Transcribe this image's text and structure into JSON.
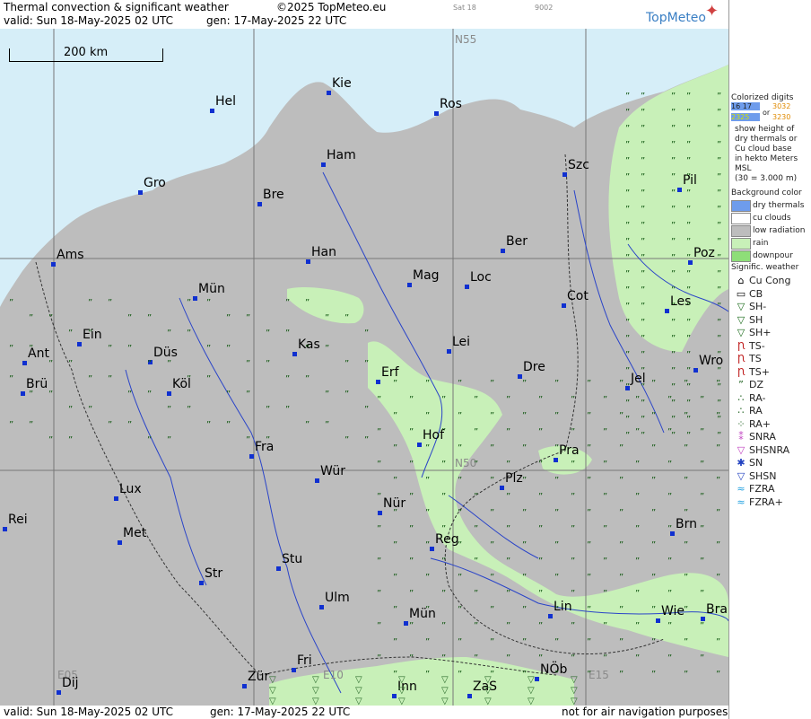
{
  "header": {
    "title": "Thermal convection & significant weather",
    "copyright": "©2025 TopMeteo.eu",
    "sat_label": "Sat 18",
    "code": "9002",
    "valid": "valid:  Sun  18-May-2025  02 UTC",
    "generated": "gen: 17-May-2025 22 UTC",
    "logo": "TopMeteo"
  },
  "footer": {
    "valid": "valid:  Sun  18-May-2025  02 UTC",
    "generated": "gen: 17-May-2025 22 UTC",
    "disclaimer": "not for air navigation purposes"
  },
  "map": {
    "scale_label": "200 km",
    "grid_labels": {
      "n55": "N55",
      "n50": "N50",
      "e05": "E05",
      "e10": "E10",
      "e15": "E15"
    },
    "cities": [
      {
        "name": "Hel"
      },
      {
        "name": "Kie"
      },
      {
        "name": "Ros"
      },
      {
        "name": "Ham"
      },
      {
        "name": "Szc"
      },
      {
        "name": "Gro"
      },
      {
        "name": "Bre"
      },
      {
        "name": "Pil"
      },
      {
        "name": "Ber"
      },
      {
        "name": "Ams"
      },
      {
        "name": "Han"
      },
      {
        "name": "Poz"
      },
      {
        "name": "Mag"
      },
      {
        "name": "Loc"
      },
      {
        "name": "Mün"
      },
      {
        "name": "Cot"
      },
      {
        "name": "Les"
      },
      {
        "name": "Ein"
      },
      {
        "name": "Kas"
      },
      {
        "name": "Lei"
      },
      {
        "name": "Ant"
      },
      {
        "name": "Düs"
      },
      {
        "name": "Wro"
      },
      {
        "name": "Dre"
      },
      {
        "name": "Erf"
      },
      {
        "name": "Brü"
      },
      {
        "name": "Köl"
      },
      {
        "name": "Jel"
      },
      {
        "name": "Hof"
      },
      {
        "name": "Fra"
      },
      {
        "name": "Pra"
      },
      {
        "name": "Wür"
      },
      {
        "name": "Plz"
      },
      {
        "name": "Lux"
      },
      {
        "name": "Nür"
      },
      {
        "name": "Rei"
      },
      {
        "name": "Brn"
      },
      {
        "name": "Met"
      },
      {
        "name": "Reg"
      },
      {
        "name": "Stu"
      },
      {
        "name": "Str"
      },
      {
        "name": "Lin"
      },
      {
        "name": "Ulm"
      },
      {
        "name": "Wie"
      },
      {
        "name": "Bra"
      },
      {
        "name": "Mün"
      },
      {
        "name": "Fri"
      },
      {
        "name": "Zür"
      },
      {
        "name": "NÖb"
      },
      {
        "name": "Dij"
      },
      {
        "name": "Inn"
      },
      {
        "name": "ZaS"
      }
    ]
  },
  "legend": {
    "digits_title": "Colorized digits",
    "digits_example_a": "16 17",
    "digits_or": "or",
    "digits_example_b1": "3032",
    "digits_example_a2": "2325",
    "digits_example_b2": "3230",
    "digits_desc": [
      "show height of",
      "dry thermals or",
      "Cu cloud base",
      "in hekto Meters",
      "MSL",
      "(30 = 3.000 m)"
    ],
    "bg_title": "Background color",
    "bg_items": [
      {
        "label": "dry thermals",
        "color": "#6e9cec"
      },
      {
        "label": "cu clouds",
        "color": "#ffffff"
      },
      {
        "label": "low radiation",
        "color": "#bdbdbd"
      },
      {
        "label": "rain",
        "color": "#c8f0b8"
      },
      {
        "label": "downpour",
        "color": "#8ede78"
      }
    ],
    "sig_title": "Signific. weather",
    "sig_items": [
      {
        "label": "Cu Cong",
        "icon": "cu-cong"
      },
      {
        "label": "CB",
        "icon": "cb"
      },
      {
        "label": "SH-",
        "icon": "shower-light"
      },
      {
        "label": "SH",
        "icon": "shower"
      },
      {
        "label": "SH+",
        "icon": "shower-heavy"
      },
      {
        "label": "TS-",
        "icon": "thunderstorm-light"
      },
      {
        "label": "TS",
        "icon": "thunderstorm"
      },
      {
        "label": "TS+",
        "icon": "thunderstorm-heavy"
      },
      {
        "label": "DZ",
        "icon": "drizzle"
      },
      {
        "label": "RA-",
        "icon": "rain-light"
      },
      {
        "label": "RA",
        "icon": "rain"
      },
      {
        "label": "RA+",
        "icon": "rain-heavy"
      },
      {
        "label": "SNRA",
        "icon": "snow-rain"
      },
      {
        "label": "SHSNRA",
        "icon": "snow-rain-shower"
      },
      {
        "label": "SN",
        "icon": "snow"
      },
      {
        "label": "SHSN",
        "icon": "snow-shower"
      },
      {
        "label": "FZRA",
        "icon": "freezing-rain"
      },
      {
        "label": "FZRA+",
        "icon": "freezing-rain-heavy"
      }
    ]
  }
}
